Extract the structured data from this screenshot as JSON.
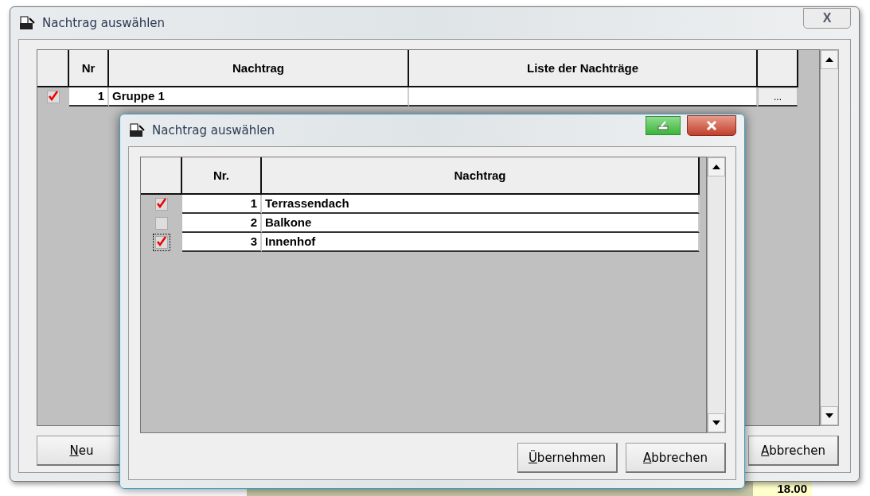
{
  "back_window": {
    "title": "Nachtrag auswählen",
    "close": "X",
    "table": {
      "columns": [
        "Nr",
        "Nachtrag",
        "Liste der Nachträge"
      ],
      "rows": [
        {
          "checked": true,
          "nr": "1",
          "nachtrag": "Gruppe 1",
          "button": "..."
        }
      ]
    },
    "buttons": [
      "Neu",
      "Abbrechen"
    ]
  },
  "front_window": {
    "title": "Nachtrag auswählen",
    "table": {
      "columns": [
        "Nr.",
        "Nachtrag"
      ],
      "rows": [
        {
          "checked": true,
          "focused": false,
          "nr": "1",
          "nachtrag": "Terrassendach"
        },
        {
          "checked": false,
          "focused": false,
          "nr": "2",
          "nachtrag": "Balkone"
        },
        {
          "checked": true,
          "focused": true,
          "nr": "3",
          "nachtrag": "Innenhof"
        }
      ]
    },
    "buttons": [
      "Übernehmen",
      "Abbrechen"
    ]
  },
  "background": {
    "value": "18.00"
  }
}
